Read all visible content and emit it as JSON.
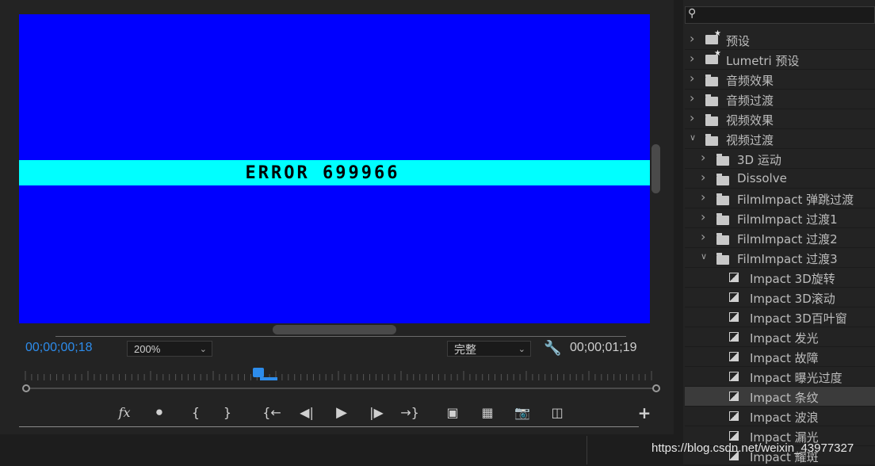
{
  "monitor": {
    "error_text": "ERROR 699966",
    "timecode_current": "00;00;00;18",
    "timecode_duration": "00;00;01;19",
    "zoom": "200%",
    "quality": "完整",
    "playback_progress": 0.37
  },
  "transport": {
    "buttons": [
      "fx-icon",
      "marker-icon",
      "mark-in-icon",
      "mark-out-icon",
      "go-to-in-icon",
      "step-back-icon",
      "play-icon",
      "step-forward-icon",
      "go-to-out-icon",
      "lift-icon",
      "extract-icon",
      "camera-icon",
      "compare-icon",
      "add-icon"
    ]
  },
  "effects": {
    "search_value": "",
    "items": [
      {
        "label": "预设",
        "type": "preset",
        "level": 0,
        "expanded": false
      },
      {
        "label": "Lumetri 预设",
        "type": "preset",
        "level": 0,
        "expanded": false
      },
      {
        "label": "音频效果",
        "type": "folder",
        "level": 0,
        "expanded": false
      },
      {
        "label": "音频过渡",
        "type": "folder",
        "level": 0,
        "expanded": false
      },
      {
        "label": "视频效果",
        "type": "folder",
        "level": 0,
        "expanded": false
      },
      {
        "label": "视频过渡",
        "type": "folder",
        "level": 0,
        "expanded": true
      },
      {
        "label": "3D 运动",
        "type": "folder",
        "level": 1,
        "expanded": false
      },
      {
        "label": "Dissolve",
        "type": "folder",
        "level": 1,
        "expanded": false
      },
      {
        "label": "FilmImpact 弹跳过渡",
        "type": "folder",
        "level": 1,
        "expanded": false
      },
      {
        "label": "FilmImpact 过渡1",
        "type": "folder",
        "level": 1,
        "expanded": false
      },
      {
        "label": "FilmImpact 过渡2",
        "type": "folder",
        "level": 1,
        "expanded": false
      },
      {
        "label": "FilmImpact 过渡3",
        "type": "folder",
        "level": 1,
        "expanded": true
      },
      {
        "label": "Impact 3D旋转",
        "type": "effect",
        "level": 2
      },
      {
        "label": "Impact 3D滚动",
        "type": "effect",
        "level": 2
      },
      {
        "label": "Impact 3D百叶窗",
        "type": "effect",
        "level": 2
      },
      {
        "label": "Impact 发光",
        "type": "effect",
        "level": 2
      },
      {
        "label": "Impact 故障",
        "type": "effect",
        "level": 2
      },
      {
        "label": "Impact 曝光过度",
        "type": "effect",
        "level": 2
      },
      {
        "label": "Impact 条纹",
        "type": "effect",
        "level": 2,
        "selected": true
      },
      {
        "label": "Impact 波浪",
        "type": "effect",
        "level": 2
      },
      {
        "label": "Impact 漏光",
        "type": "effect",
        "level": 2
      },
      {
        "label": "Impact 耀斑",
        "type": "effect",
        "level": 2
      }
    ]
  },
  "watermark": "https://blog.csdn.net/weixin_43977327"
}
